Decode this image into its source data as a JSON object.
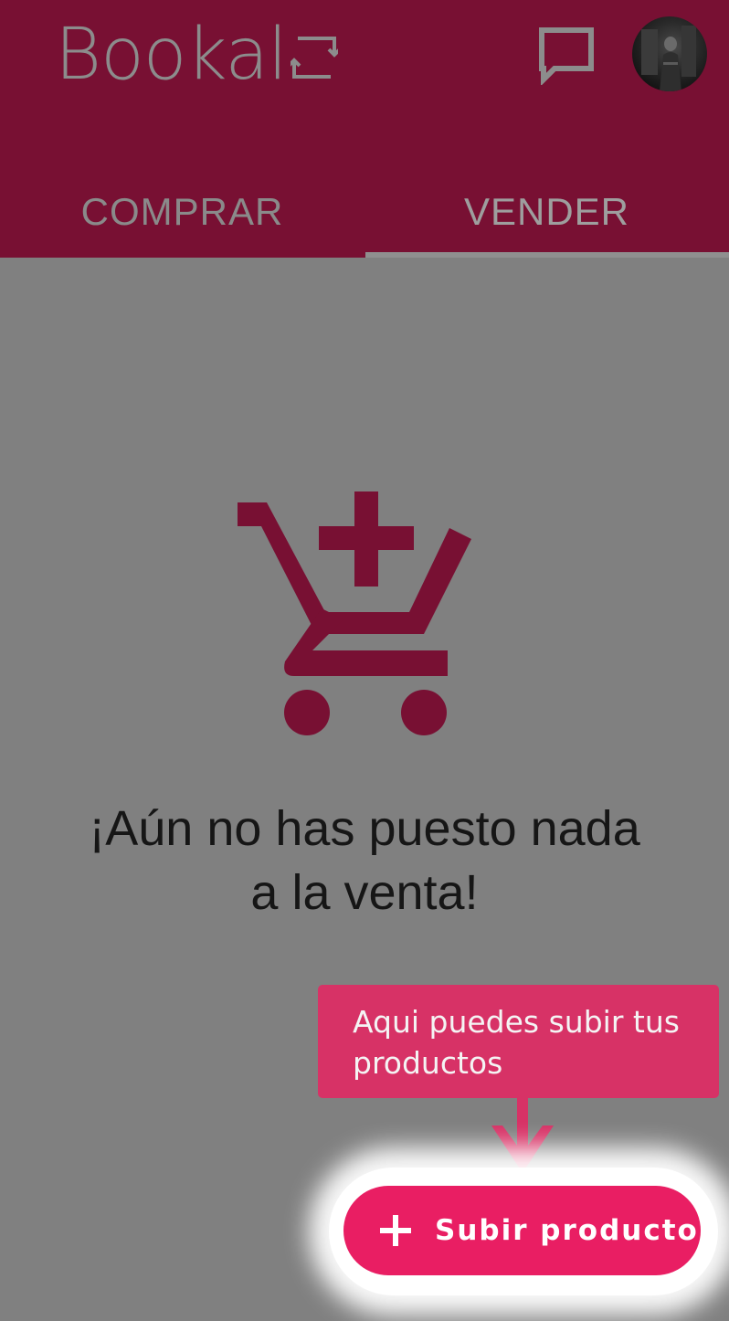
{
  "app": {
    "brand_name": "Bookal"
  },
  "header": {
    "chat_icon": "chat-bubble-icon",
    "avatar_icon": "user-avatar"
  },
  "tabs": [
    {
      "label": "COMPRAR",
      "active": false
    },
    {
      "label": "VENDER",
      "active": true
    }
  ],
  "empty_state": {
    "icon": "cart-plus-icon",
    "line1": "¡Aún no has puesto nada",
    "line2": "a la venta!"
  },
  "tooltip": {
    "text": "Aqui puedes subir tus productos"
  },
  "fab": {
    "icon": "plus-icon",
    "label": "Subir producto"
  },
  "colors": {
    "app_bar": "#781033",
    "overlay_background": "#808080",
    "accent": "#e91e63",
    "tooltip": "#d73266",
    "illustration": "#781033"
  }
}
